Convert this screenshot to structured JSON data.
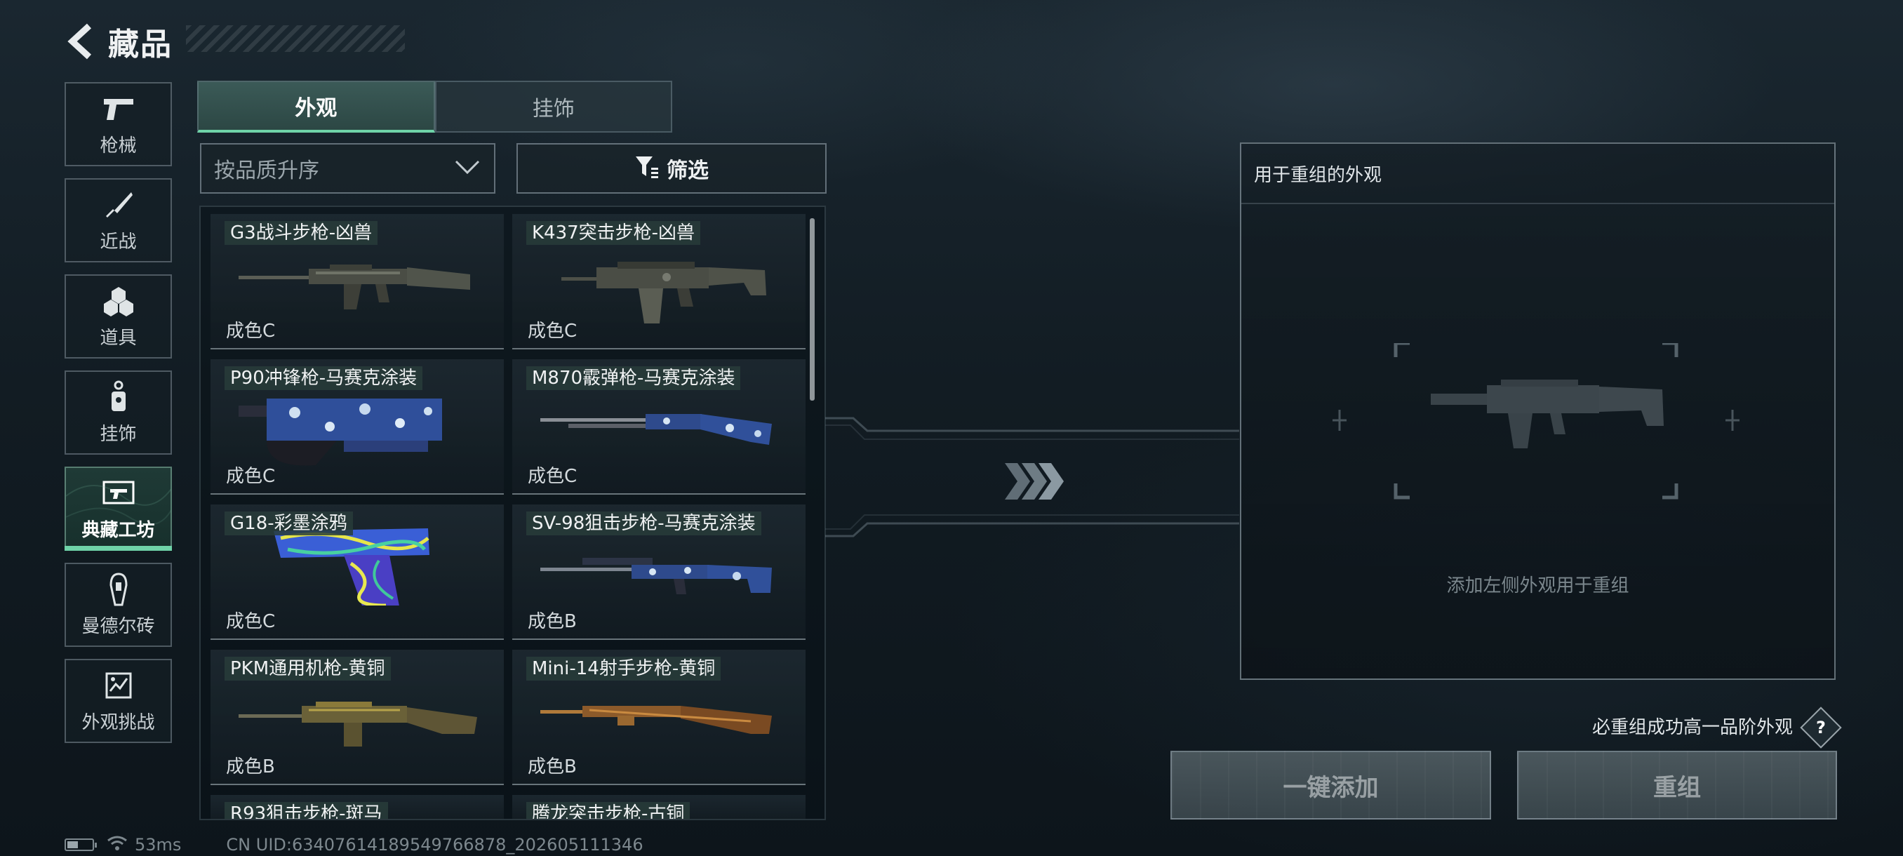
{
  "header": {
    "title": "藏品"
  },
  "sidebar": {
    "items": [
      {
        "label": "枪械",
        "icon": "pistol-icon"
      },
      {
        "label": "近战",
        "icon": "knife-icon"
      },
      {
        "label": "道具",
        "icon": "grenades-icon"
      },
      {
        "label": "挂饰",
        "icon": "charm-icon"
      },
      {
        "label": "典藏工坊",
        "icon": "workshop-icon",
        "active": true
      },
      {
        "label": "曼德尔砖",
        "icon": "brick-icon"
      },
      {
        "label": "外观挑战",
        "icon": "challenge-icon"
      }
    ]
  },
  "tabs": [
    {
      "label": "外观",
      "active": true
    },
    {
      "label": "挂饰",
      "active": false
    }
  ],
  "sort": {
    "value": "按品质升序"
  },
  "filter": {
    "label": "筛选"
  },
  "items": [
    {
      "name": "G3战斗步枪-凶兽",
      "grade": "成色C"
    },
    {
      "name": "K437突击步枪-凶兽",
      "grade": "成色C"
    },
    {
      "name": "P90冲锋枪-马赛克涂装",
      "grade": "成色C"
    },
    {
      "name": "M870霰弹枪-马赛克涂装",
      "grade": "成色C"
    },
    {
      "name": "G18-彩墨涂鸦",
      "grade": "成色C"
    },
    {
      "name": "SV-98狙击步枪-马赛克涂装",
      "grade": "成色B"
    },
    {
      "name": "PKM通用机枪-黄铜",
      "grade": "成色B"
    },
    {
      "name": "Mini-14射手步枪-黄铜",
      "grade": "成色B"
    },
    {
      "name": "R93狙击步枪-斑马",
      "grade": ""
    },
    {
      "name": "腾龙突击步枪-古铜",
      "grade": ""
    }
  ],
  "recombine": {
    "title": "用于重组的外观",
    "hint": "添加左侧外观用于重组",
    "info": "必重组成功高一品阶外观",
    "help": "?",
    "add_all_label": "一键添加",
    "recombine_label": "重组"
  },
  "status": {
    "ping": "53ms",
    "uid": "CN UID:6340761418954976687​8_202605111346",
    "battery_level": 0.45
  },
  "colors": {
    "accent": "#6fd3a8",
    "panel_border": "#a9b9c3"
  }
}
